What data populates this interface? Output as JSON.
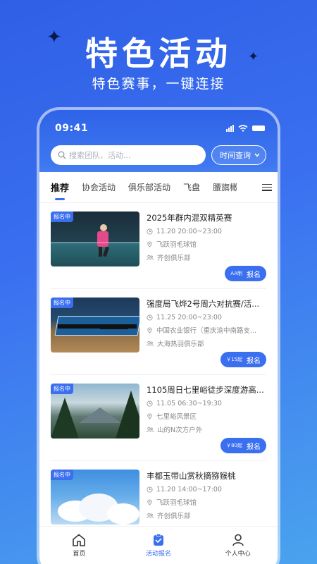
{
  "promo": {
    "title": "特色活动",
    "subtitle": "特色赛事，一键连接"
  },
  "status_bar": {
    "time": "09:41"
  },
  "search": {
    "placeholder": "搜索团队、活动...",
    "time_filter_label": "时间查询"
  },
  "tabs": [
    {
      "label": "推荐",
      "active": true
    },
    {
      "label": "协会活动"
    },
    {
      "label": "俱乐部活动"
    },
    {
      "label": "飞盘"
    },
    {
      "label": "腰旗橄"
    }
  ],
  "activities": [
    {
      "badge": "报名中",
      "title": "2025年群内混双精英赛",
      "time": "11.20 20:00~23:00",
      "location": "飞跃羽毛球馆",
      "organizer": "齐创俱乐部",
      "price": "AA制",
      "button": "报名",
      "image": "badminton-night"
    },
    {
      "badge": "报名中",
      "title": "强度局飞烨2号周六对抗赛/活...",
      "time": "11.25 20:00~23:00",
      "location": "中国农业银行（重庆渝中南路支...",
      "organizer": "大海热羽俱乐部",
      "price": "￥15起",
      "button": "报名",
      "image": "ping-pong-table"
    },
    {
      "badge": "报名中",
      "title": "1105周日七里峪徒步深度游高...",
      "time": "11.05 06:30~19:30",
      "location": "七里峪风景区",
      "organizer": "山的N次方户外",
      "price": "￥80起",
      "button": "报名",
      "image": "mountain-valley"
    },
    {
      "badge": "报名中",
      "title": "丰都玉带山赏秋摘猕猴桃",
      "time": "11.20 14:00~17:00",
      "location": "飞跃羽毛球馆",
      "organizer": "齐创俱乐部",
      "price": "",
      "button": "",
      "image": "blue-sky-clouds"
    }
  ],
  "bottom_nav": [
    {
      "label": "首页",
      "icon": "home-icon"
    },
    {
      "label": "活动报名",
      "icon": "activity-icon",
      "active": true
    },
    {
      "label": "个人中心",
      "icon": "user-icon"
    }
  ],
  "colors": {
    "accent": "#3a6ff0",
    "bg_top": "#2f5fe6",
    "bg_bottom": "#4aa3ee"
  }
}
